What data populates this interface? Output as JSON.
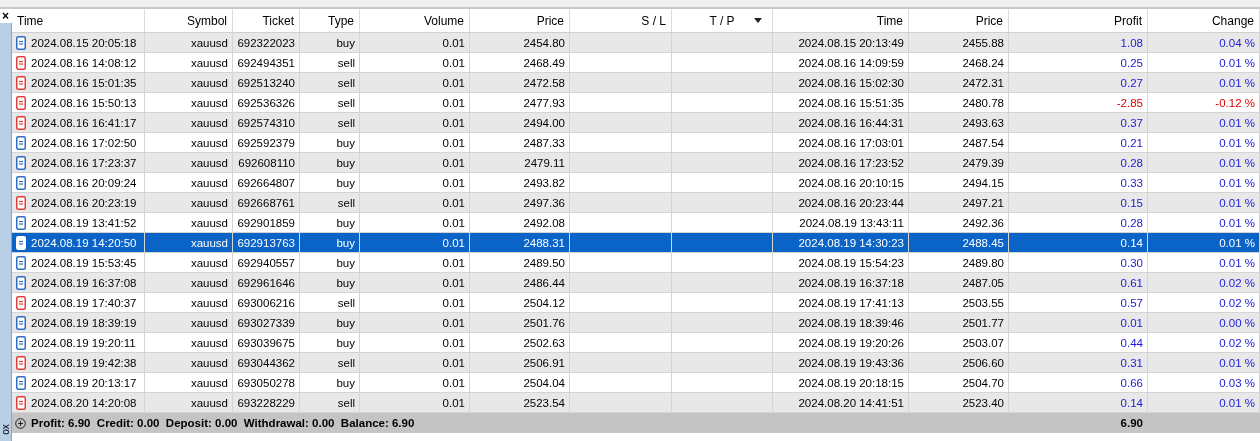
{
  "side_panel": {
    "close": "×",
    "label": "ox"
  },
  "table": {
    "columns": [
      {
        "label": "Time",
        "sorted": false
      },
      {
        "label": "Symbol",
        "sorted": false
      },
      {
        "label": "Ticket",
        "sorted": false
      },
      {
        "label": "Type",
        "sorted": false
      },
      {
        "label": "Volume",
        "sorted": false
      },
      {
        "label": "Price",
        "sorted": false
      },
      {
        "label": "S / L",
        "sorted": false
      },
      {
        "label": "T / P",
        "sorted": true
      },
      {
        "label": "Time",
        "sorted": false
      },
      {
        "label": "Price",
        "sorted": false
      },
      {
        "label": "Profit",
        "sorted": false
      },
      {
        "label": "Change",
        "sorted": false
      }
    ],
    "rows": [
      {
        "kind": "buy",
        "selected": false,
        "negative": false,
        "cells": [
          "2024.08.15 20:05:18",
          "xauusd",
          "692322023",
          "buy",
          "0.01",
          "2454.80",
          "",
          "",
          "2024.08.15 20:13:49",
          "2455.88",
          "1.08",
          "0.04 %"
        ]
      },
      {
        "kind": "sell",
        "selected": false,
        "negative": false,
        "cells": [
          "2024.08.16 14:08:12",
          "xauusd",
          "692494351",
          "sell",
          "0.01",
          "2468.49",
          "",
          "",
          "2024.08.16 14:09:59",
          "2468.24",
          "0.25",
          "0.01 %"
        ]
      },
      {
        "kind": "sell",
        "selected": false,
        "negative": false,
        "cells": [
          "2024.08.16 15:01:35",
          "xauusd",
          "692513240",
          "sell",
          "0.01",
          "2472.58",
          "",
          "",
          "2024.08.16 15:02:30",
          "2472.31",
          "0.27",
          "0.01 %"
        ]
      },
      {
        "kind": "sell",
        "selected": false,
        "negative": true,
        "cells": [
          "2024.08.16 15:50:13",
          "xauusd",
          "692536326",
          "sell",
          "0.01",
          "2477.93",
          "",
          "",
          "2024.08.16 15:51:35",
          "2480.78",
          "-2.85",
          "-0.12 %"
        ]
      },
      {
        "kind": "sell",
        "selected": false,
        "negative": false,
        "cells": [
          "2024.08.16 16:41:17",
          "xauusd",
          "692574310",
          "sell",
          "0.01",
          "2494.00",
          "",
          "",
          "2024.08.16 16:44:31",
          "2493.63",
          "0.37",
          "0.01 %"
        ]
      },
      {
        "kind": "buy",
        "selected": false,
        "negative": false,
        "cells": [
          "2024.08.16 17:02:50",
          "xauusd",
          "692592379",
          "buy",
          "0.01",
          "2487.33",
          "",
          "",
          "2024.08.16 17:03:01",
          "2487.54",
          "0.21",
          "0.01 %"
        ]
      },
      {
        "kind": "buy",
        "selected": false,
        "negative": false,
        "cells": [
          "2024.08.16 17:23:37",
          "xauusd",
          "692608110",
          "buy",
          "0.01",
          "2479.11",
          "",
          "",
          "2024.08.16 17:23:52",
          "2479.39",
          "0.28",
          "0.01 %"
        ]
      },
      {
        "kind": "buy",
        "selected": false,
        "negative": false,
        "cells": [
          "2024.08.16 20:09:24",
          "xauusd",
          "692664807",
          "buy",
          "0.01",
          "2493.82",
          "",
          "",
          "2024.08.16 20:10:15",
          "2494.15",
          "0.33",
          "0.01 %"
        ]
      },
      {
        "kind": "sell",
        "selected": false,
        "negative": false,
        "cells": [
          "2024.08.16 20:23:19",
          "xauusd",
          "692668761",
          "sell",
          "0.01",
          "2497.36",
          "",
          "",
          "2024.08.16 20:23:44",
          "2497.21",
          "0.15",
          "0.01 %"
        ]
      },
      {
        "kind": "buy",
        "selected": false,
        "negative": false,
        "cells": [
          "2024.08.19 13:41:52",
          "xauusd",
          "692901859",
          "buy",
          "0.01",
          "2492.08",
          "",
          "",
          "2024.08.19 13:43:11",
          "2492.36",
          "0.28",
          "0.01 %"
        ]
      },
      {
        "kind": "buy",
        "selected": true,
        "negative": false,
        "cells": [
          "2024.08.19 14:20:50",
          "xauusd",
          "692913763",
          "buy",
          "0.01",
          "2488.31",
          "",
          "",
          "2024.08.19 14:30:23",
          "2488.45",
          "0.14",
          "0.01 %"
        ]
      },
      {
        "kind": "buy",
        "selected": false,
        "negative": false,
        "cells": [
          "2024.08.19 15:53:45",
          "xauusd",
          "692940557",
          "buy",
          "0.01",
          "2489.50",
          "",
          "",
          "2024.08.19 15:54:23",
          "2489.80",
          "0.30",
          "0.01 %"
        ]
      },
      {
        "kind": "buy",
        "selected": false,
        "negative": false,
        "cells": [
          "2024.08.19 16:37:08",
          "xauusd",
          "692961646",
          "buy",
          "0.01",
          "2486.44",
          "",
          "",
          "2024.08.19 16:37:18",
          "2487.05",
          "0.61",
          "0.02 %"
        ]
      },
      {
        "kind": "sell",
        "selected": false,
        "negative": false,
        "cells": [
          "2024.08.19 17:40:37",
          "xauusd",
          "693006216",
          "sell",
          "0.01",
          "2504.12",
          "",
          "",
          "2024.08.19 17:41:13",
          "2503.55",
          "0.57",
          "0.02 %"
        ]
      },
      {
        "kind": "buy",
        "selected": false,
        "negative": false,
        "cells": [
          "2024.08.19 18:39:19",
          "xauusd",
          "693027339",
          "buy",
          "0.01",
          "2501.76",
          "",
          "",
          "2024.08.19 18:39:46",
          "2501.77",
          "0.01",
          "0.00 %"
        ]
      },
      {
        "kind": "buy",
        "selected": false,
        "negative": false,
        "cells": [
          "2024.08.19 19:20:11",
          "xauusd",
          "693039675",
          "buy",
          "0.01",
          "2502.63",
          "",
          "",
          "2024.08.19 19:20:26",
          "2503.07",
          "0.44",
          "0.02 %"
        ]
      },
      {
        "kind": "sell",
        "selected": false,
        "negative": false,
        "cells": [
          "2024.08.19 19:42:38",
          "xauusd",
          "693044362",
          "sell",
          "0.01",
          "2506.91",
          "",
          "",
          "2024.08.19 19:43:36",
          "2506.60",
          "0.31",
          "0.01 %"
        ]
      },
      {
        "kind": "buy",
        "selected": false,
        "negative": false,
        "cells": [
          "2024.08.19 20:13:17",
          "xauusd",
          "693050278",
          "buy",
          "0.01",
          "2504.04",
          "",
          "",
          "2024.08.19 20:18:15",
          "2504.70",
          "0.66",
          "0.03 %"
        ]
      },
      {
        "kind": "sell",
        "selected": false,
        "negative": false,
        "cells": [
          "2024.08.20 14:20:08",
          "xauusd",
          "693228229",
          "sell",
          "0.01",
          "2523.54",
          "",
          "",
          "2024.08.20 14:41:51",
          "2523.40",
          "0.14",
          "0.01 %"
        ]
      }
    ],
    "summary": {
      "text": "Profit: 6.90  Credit: 0.00  Deposit: 0.00  Withdrawal: 0.00  Balance: 6.90",
      "total_profit": "6.90"
    }
  }
}
